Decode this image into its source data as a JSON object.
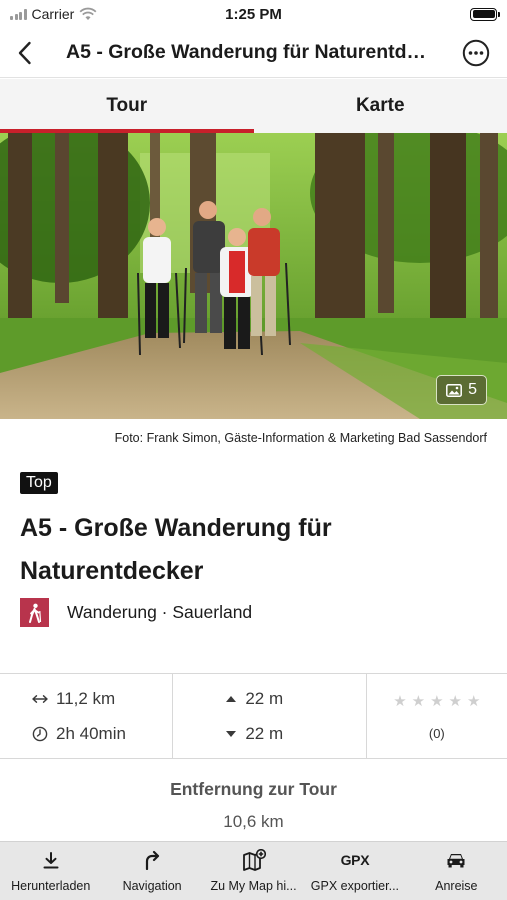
{
  "status_bar": {
    "carrier": "Carrier",
    "time": "1:25 PM"
  },
  "nav": {
    "title": "A5 - Große Wanderung für Naturentdecker",
    "back_icon": "chevron-left-icon",
    "more_icon": "more-icon"
  },
  "tabs": [
    {
      "label": "Tour",
      "active": true
    },
    {
      "label": "Karte",
      "active": false
    }
  ],
  "hero": {
    "gallery_count": "5"
  },
  "photo_credit": "Foto: Frank Simon, Gäste-Information & Marketing Bad Sassendorf",
  "badge": "Top",
  "title": "A5 - Große Wanderung für Naturentdecker",
  "category": {
    "label": "Wanderung · Sauerland",
    "color": "#b8344c",
    "icon": "hiking-icon"
  },
  "stats": {
    "distance": "11,2 km",
    "duration": "2h 40min",
    "ascent": "22 m",
    "descent": "22 m",
    "rating_count": "(0)",
    "rating_value": 0,
    "rating_max": 5
  },
  "distance_to_tour": {
    "label": "Entfernung zur Tour",
    "value": "10,6 km"
  },
  "toolbar": [
    {
      "label": "Herunterladen",
      "icon": "download-icon"
    },
    {
      "label": "Navigation",
      "icon": "turn-right-icon"
    },
    {
      "label": "Zu My Map hi...",
      "icon": "add-to-map-icon"
    },
    {
      "label": "GPX exportier...",
      "icon": "GPX"
    },
    {
      "label": "Anreise",
      "icon": "car-icon"
    }
  ],
  "colors": {
    "accent": "#c8202b",
    "tab_bg": "#f4f4f4",
    "toolbar_bg": "#e7e7e7"
  }
}
